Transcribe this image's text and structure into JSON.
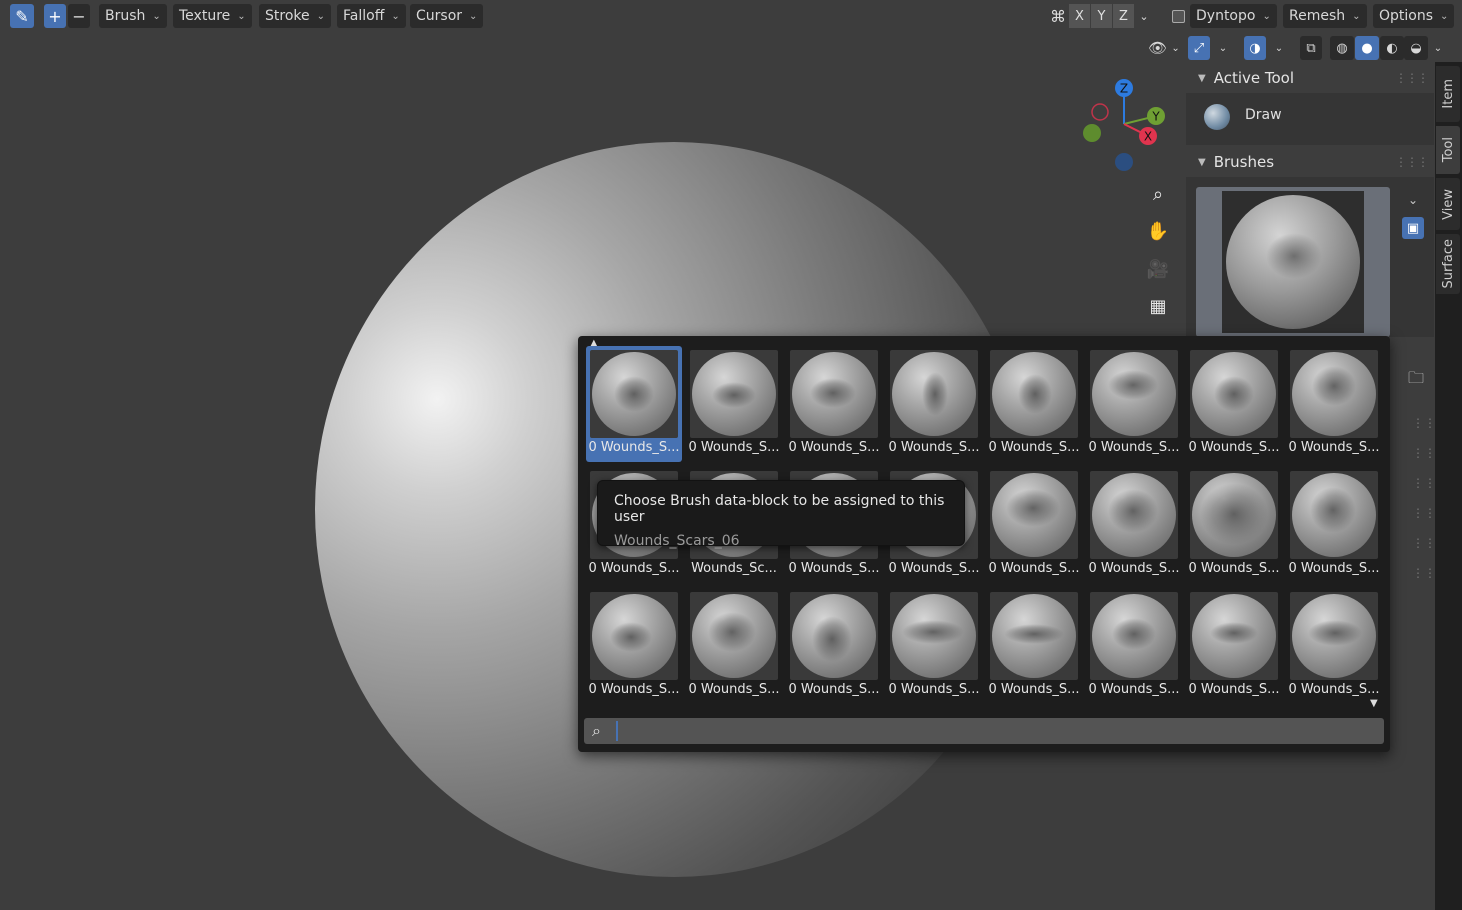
{
  "header": {
    "menus": [
      "Brush",
      "Texture",
      "Stroke",
      "Falloff",
      "Cursor"
    ],
    "axes": [
      "X",
      "Y",
      "Z"
    ],
    "right_menus": [
      "Dyntopo",
      "Remesh",
      "Options"
    ]
  },
  "gizmo": {
    "z": "Z",
    "y": "Y",
    "x": "X"
  },
  "panel": {
    "active_tool_header": "Active Tool",
    "tool_name": "Draw",
    "brushes_header": "Brushes"
  },
  "tabs": [
    "Item",
    "Tool",
    "View",
    "Surface"
  ],
  "popup": {
    "labels": [
      "0 Wounds_S...",
      "0 Wounds_S...",
      "0 Wounds_S...",
      "0 Wounds_S...",
      "0 Wounds_S...",
      "0 Wounds_S...",
      "0 Wounds_S...",
      "0 Wounds_S...",
      "0 Wounds_S...",
      "Wounds_Sc...",
      "0 Wounds_S...",
      "0 Wounds_S...",
      "0 Wounds_S...",
      "0 Wounds_S...",
      "0 Wounds_S...",
      "0 Wounds_S...",
      "0 Wounds_S...",
      "0 Wounds_S...",
      "0 Wounds_S...",
      "0 Wounds_S...",
      "0 Wounds_S...",
      "0 Wounds_S...",
      "0 Wounds_S...",
      "0 Wounds_S..."
    ],
    "selected_index": 0
  },
  "tooltip": {
    "description": "Choose Brush data-block to be assigned to this user",
    "value": "Wounds_Scars_06"
  },
  "search": {
    "placeholder": ""
  }
}
